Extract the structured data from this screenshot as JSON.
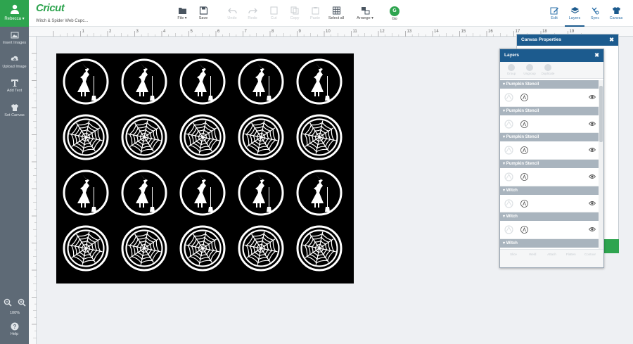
{
  "sidebar": {
    "user_name": "Rebecca ▾",
    "tools": [
      {
        "label": "Insert Images",
        "icon": "image-icon"
      },
      {
        "label": "Upload Image",
        "icon": "upload-icon"
      },
      {
        "label": "Add Text",
        "icon": "text-icon"
      },
      {
        "label": "Set Canvas",
        "icon": "shirt-icon"
      }
    ],
    "zoom_level": "100%",
    "help_label": "Help"
  },
  "header": {
    "logo": "Cricut",
    "project_name": "Witch & Spider Web Cupc...",
    "toolbar": {
      "file": "File ▾",
      "save": "Save",
      "undo": "Undo",
      "redo": "Redo",
      "cut": "Cut",
      "copy": "Copy",
      "paste": "Paste",
      "select_all": "Select all",
      "arrange": "Arrange ▾",
      "go": "Go",
      "go_letter": "G"
    },
    "right_tabs": {
      "edit": "Edit",
      "layers": "Layers",
      "sync": "Sync",
      "canvas": "Canvas"
    }
  },
  "ruler": {
    "marks": [
      "1",
      "2",
      "3",
      "4",
      "5",
      "6",
      "7",
      "8",
      "9",
      "10",
      "11",
      "12",
      "13",
      "14",
      "15",
      "16",
      "17",
      "18",
      "19"
    ]
  },
  "canvas_grid": {
    "rows": [
      "witch",
      "web",
      "witch",
      "web"
    ],
    "columns": 5
  },
  "canvas_properties": {
    "title": "Canvas Properties",
    "close": "✖"
  },
  "layers_panel": {
    "title": "Layers",
    "close": "✖",
    "top_tools": [
      "Group",
      "Ungroup",
      "Duplicate"
    ],
    "bottom_tools": [
      "Slice",
      "Weld",
      "Attach",
      "Flatten",
      "Contour"
    ],
    "groups": [
      {
        "name": "Pumpkin Stencil"
      },
      {
        "name": "Pumpkin Stencil"
      },
      {
        "name": "Pumpkin Stencil"
      },
      {
        "name": "Pumpkin Stencil"
      },
      {
        "name": "Witch"
      },
      {
        "name": "Witch"
      },
      {
        "name": "Witch"
      }
    ]
  },
  "colors": {
    "brand_green": "#2ea44f",
    "panel_blue": "#1c5b8e",
    "sidebar_gray": "#5e6a76",
    "mat_black": "#000000"
  }
}
